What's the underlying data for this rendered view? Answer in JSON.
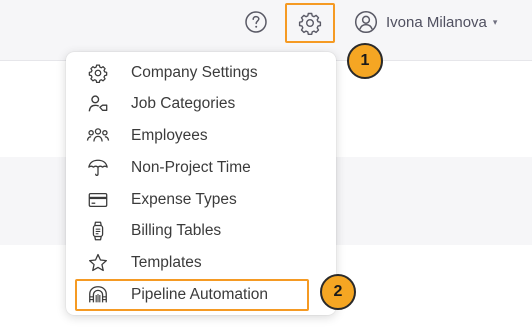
{
  "header": {
    "help_icon": "question-circle-icon",
    "settings_icon": "gear-icon",
    "user": {
      "name": "Ivona Milanova",
      "avatar_icon": "user-circle-icon",
      "caret": "▾"
    }
  },
  "settings_menu": {
    "items": [
      {
        "label": "Company Settings",
        "icon": "gear-icon"
      },
      {
        "label": "Job Categories",
        "icon": "person-tag-icon"
      },
      {
        "label": "Employees",
        "icon": "people-group-icon"
      },
      {
        "label": "Non-Project Time",
        "icon": "umbrella-icon"
      },
      {
        "label": "Expense Types",
        "icon": "credit-card-icon"
      },
      {
        "label": "Billing Tables",
        "icon": "watch-icon"
      },
      {
        "label": "Templates",
        "icon": "star-icon"
      },
      {
        "label": "Pipeline Automation",
        "icon": "pipeline-icon",
        "highlighted": true
      }
    ]
  },
  "annotations": {
    "step1": "1",
    "step2": "2"
  },
  "colors": {
    "highlight": "#f59a23",
    "badge": "#f5a623",
    "header_bg": "#f6f6f8",
    "text": "#3b3b3b"
  }
}
